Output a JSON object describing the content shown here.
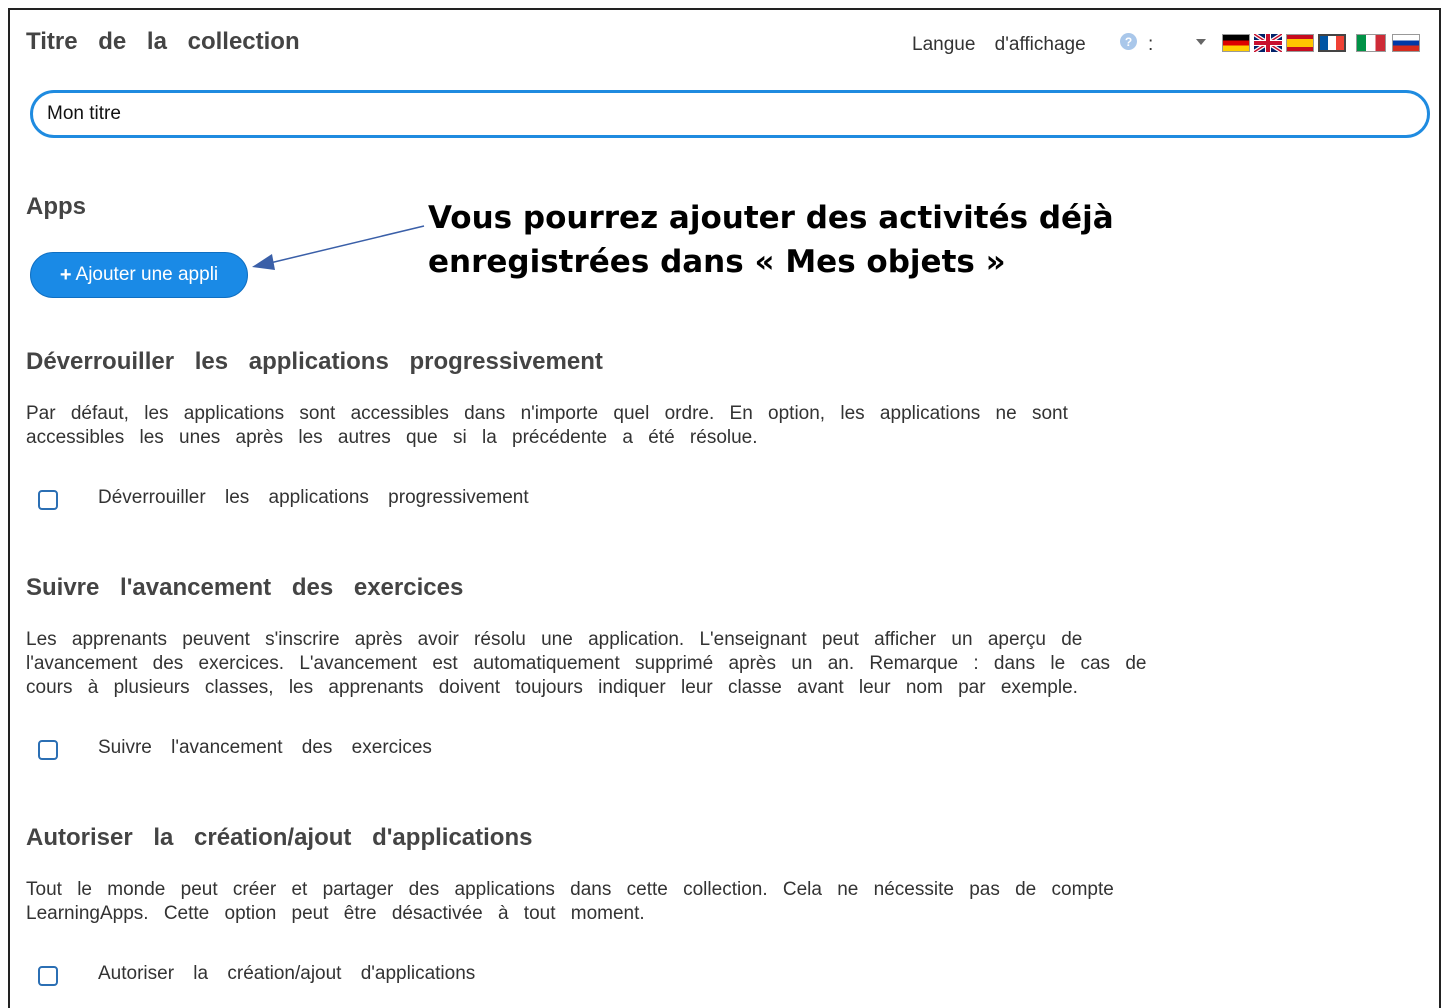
{
  "collection": {
    "title_heading": "Titre de la collection",
    "title_value": "Mon titre"
  },
  "language": {
    "label": "Langue d'affichage",
    "colon": ":",
    "help_icon": "?",
    "flags": [
      "de",
      "en",
      "es",
      "fr",
      "it",
      "ru"
    ],
    "selected": "fr"
  },
  "apps": {
    "heading": "Apps",
    "add_button_icon": "+",
    "add_button_label": "Ajouter une appli"
  },
  "annotation": {
    "line1": "Vous pourrez ajouter des activités déjà",
    "line2": "enregistrées dans « Mes objets »"
  },
  "unlock": {
    "heading": "Déverrouiller les applications progressivement",
    "line1": "Par défaut, les applications sont accessibles dans n'importe quel ordre. En option, les applications ne sont",
    "line2": "accessibles les unes après les autres que si la précédente a été résolue.",
    "checkbox_label": "Déverrouiller les applications progressivement",
    "checked": false
  },
  "progress": {
    "heading": "Suivre l'avancement des exercices",
    "line1": "Les apprenants peuvent s'inscrire après avoir résolu une application. L'enseignant peut afficher un aperçu de",
    "line2": "l'avancement des exercices. L'avancement est automatiquement supprimé après un an. Remarque : dans le cas de",
    "line3": "cours à plusieurs classes, les apprenants doivent toujours indiquer leur classe avant leur nom par exemple.",
    "checkbox_label": "Suivre l'avancement des exercices",
    "checked": false
  },
  "allow": {
    "heading": "Autoriser la création/ajout d'applications",
    "line1": "Tout le monde peut créer et partager des applications dans cette collection. Cela ne nécessite pas de compte",
    "line2": "LearningApps. Cette option peut être désactivée à tout moment.",
    "checkbox_label": "Autoriser la création/ajout d'applications",
    "checked": false
  },
  "colors": {
    "accent": "#1a8ae6",
    "input_border": "#1f8be0",
    "checkbox_border": "#2b6fb4",
    "arrow": "#3a5fa8"
  }
}
